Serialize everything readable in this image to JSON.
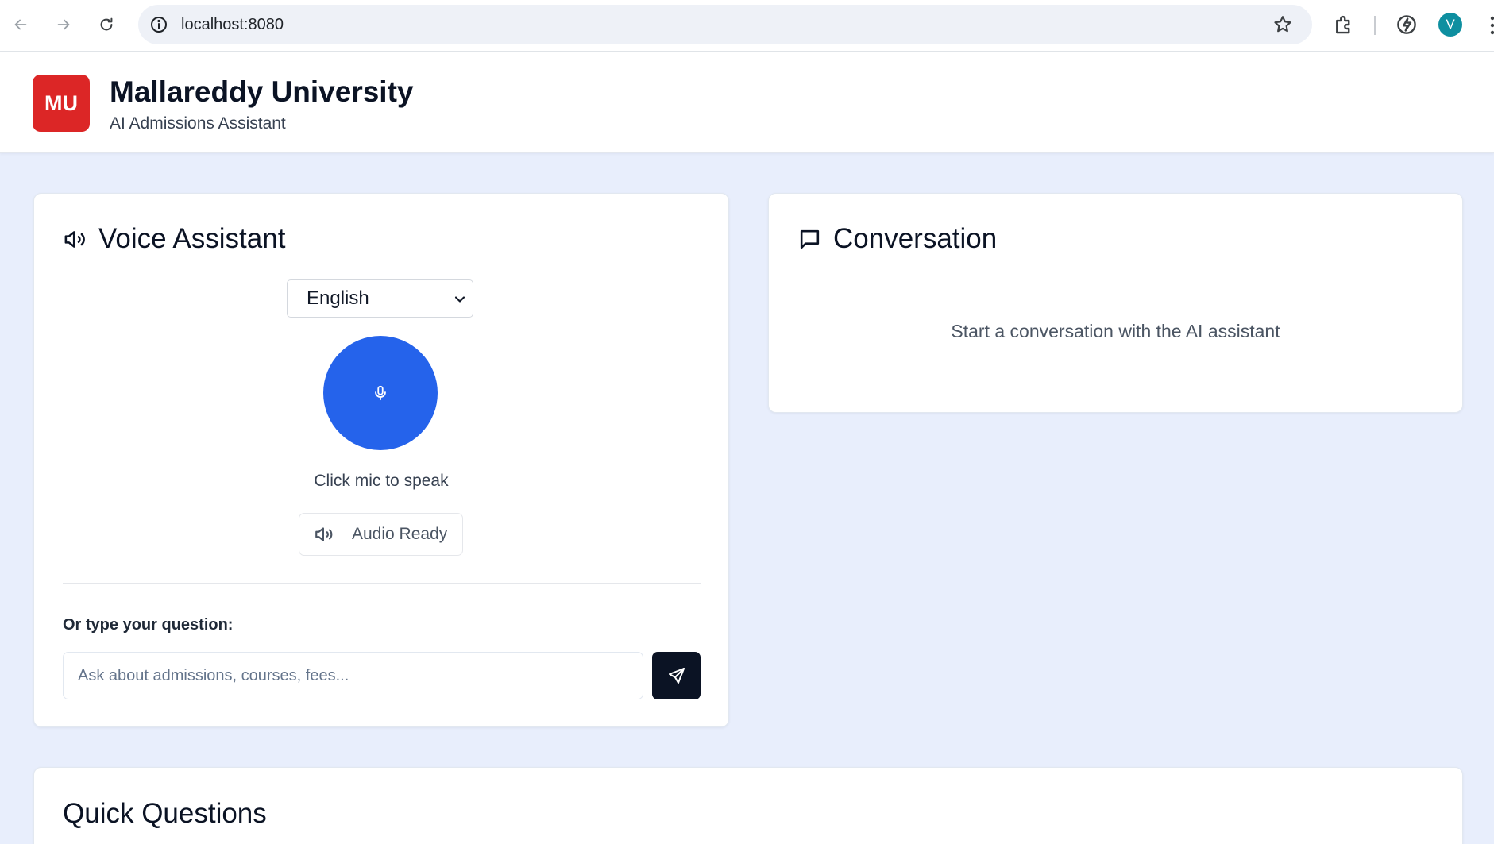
{
  "browser": {
    "url": "localhost:8080",
    "profile_initial": "V",
    "icons": [
      "back-icon",
      "forward-icon",
      "reload-icon",
      "site-info-icon",
      "bookmark-star-icon",
      "extensions-icon",
      "performance-icon",
      "kebab-menu-icon"
    ]
  },
  "header": {
    "logo_text": "MU",
    "title": "Mallareddy University",
    "subtitle": "AI Admissions Assistant",
    "brand_color": "#dc2626"
  },
  "voice_panel": {
    "title": "Voice Assistant",
    "language_selected": "English",
    "mic_hint": "Click mic to speak",
    "audio_status": "Audio Ready",
    "type_label": "Or type your question:",
    "input_value": "",
    "input_placeholder": "Ask about admissions, courses, fees...",
    "mic_color": "#2563eb"
  },
  "conversation_panel": {
    "title": "Conversation",
    "empty_text": "Start a conversation with the AI assistant"
  },
  "quick_panel": {
    "title": "Quick Questions"
  }
}
